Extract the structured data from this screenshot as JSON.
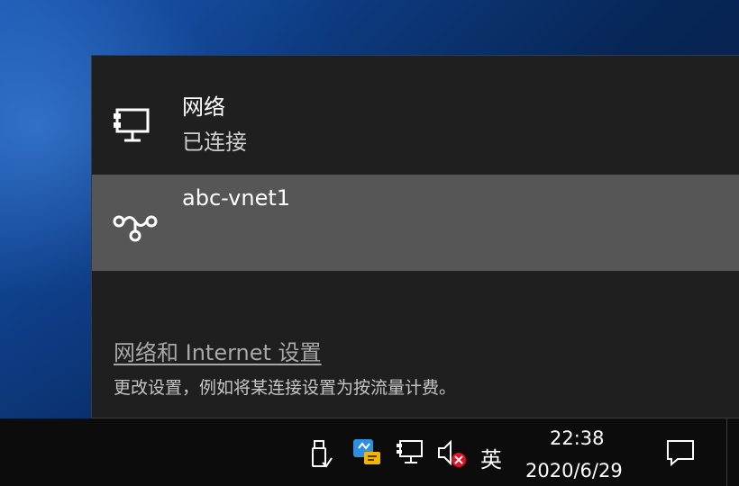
{
  "network_flyout": {
    "connected_network": {
      "name": "网络",
      "status": "已连接",
      "icon": "wired-network-icon"
    },
    "vpn_connection": {
      "name": "abc-vnet1",
      "icon": "vpn-icon"
    },
    "settings_link": "网络和 Internet 设置",
    "settings_description": "更改设置，例如将某连接设置为按流量计费。"
  },
  "taskbar": {
    "tray_icons": [
      "usb-drive-icon",
      "chat-app-icon",
      "network-icon",
      "volume-muted-icon"
    ],
    "input_method": "英",
    "clock_time": "22:38",
    "clock_date": "2020/6/29",
    "notification_icon": "action-center-icon"
  },
  "colors": {
    "flyout_bg": "#1f1f1f",
    "selected_item_bg": "#565656",
    "taskbar_bg": "#0c0c0c",
    "muted_badge": "#e81123"
  }
}
